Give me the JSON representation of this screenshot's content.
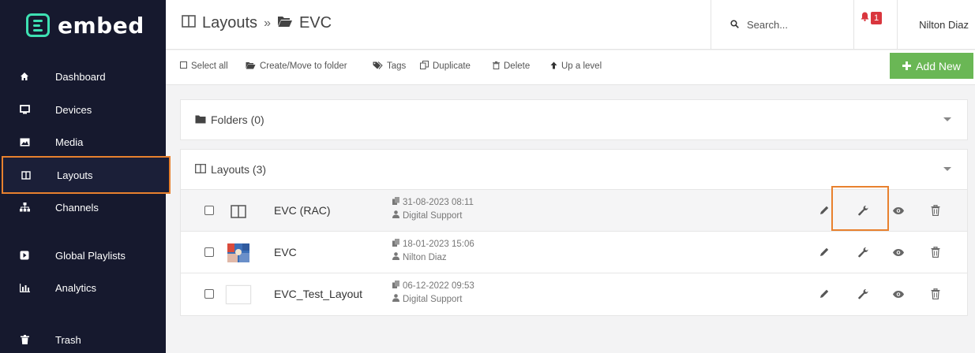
{
  "brand": {
    "name": "embed",
    "accent": "#3ee0b2"
  },
  "sidebar": {
    "items": [
      {
        "label": "Dashboard",
        "icon": "home-icon"
      },
      {
        "label": "Devices",
        "icon": "monitor-icon"
      },
      {
        "label": "Media",
        "icon": "image-icon"
      },
      {
        "label": "Layouts",
        "icon": "layout-columns-icon",
        "active": true
      },
      {
        "label": "Channels",
        "icon": "sitemap-icon"
      },
      {
        "label": "Global Playlists",
        "icon": "play-square-icon"
      },
      {
        "label": "Analytics",
        "icon": "bar-chart-icon"
      },
      {
        "label": "Trash",
        "icon": "trash-icon"
      }
    ]
  },
  "header": {
    "section": "Layouts",
    "separator": "»",
    "folder": "EVC",
    "search_placeholder": "Search...",
    "notifications": "1",
    "user": "Nilton Diaz"
  },
  "toolbar": {
    "select_all": "Select all",
    "move_to_folder": "Create/Move to folder",
    "tags": "Tags",
    "duplicate": "Duplicate",
    "delete": "Delete",
    "up_level": "Up a level",
    "add_new": "Add New",
    "add_color": "#6ab755"
  },
  "folders_panel": {
    "title": "Folders (0)"
  },
  "layouts_panel": {
    "title": "Layouts (3)"
  },
  "layouts": [
    {
      "name": "EVC (RAC)",
      "date": "31-08-2023 08:11",
      "owner": "Digital Support",
      "thumb": "layout-placeholder-icon"
    },
    {
      "name": "EVC",
      "date": "18-01-2023 15:06",
      "owner": "Nilton Diaz",
      "thumb": "image-thumbnail"
    },
    {
      "name": "EVC_Test_Layout",
      "date": "06-12-2022 09:53",
      "owner": "Digital Support",
      "thumb": "blank-thumbnail"
    }
  ],
  "highlight_color": "#e8812e"
}
